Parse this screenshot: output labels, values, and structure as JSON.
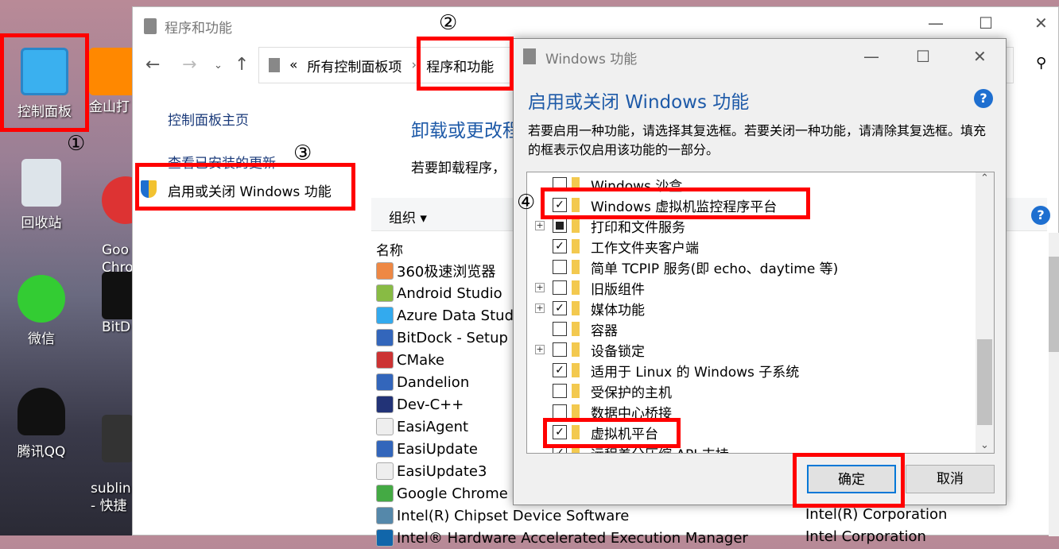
{
  "desktop": {
    "icons": [
      {
        "label": "控制面板"
      },
      {
        "label": "回收站"
      },
      {
        "label": "微信"
      },
      {
        "label": "腾讯QQ"
      }
    ],
    "icons_col2": [
      {
        "label": "金山打"
      },
      {
        "label": "Goo\nChro"
      },
      {
        "label": "BitD"
      },
      {
        "label": "sublin\n- 快捷"
      }
    ]
  },
  "explorer": {
    "title": "程序和功能",
    "breadcrumb": {
      "prefix": "«",
      "parent": "所有控制面板项",
      "sep": "›",
      "current": "程序和功能"
    },
    "left": {
      "home": "控制面板主页",
      "updates": "查看已安装的更新",
      "features": "启用或关闭 Windows 功能"
    },
    "main": {
      "heading": "卸载或更改程",
      "desc": "若要卸载程序，",
      "organize": "组织 ▾",
      "col_name": "名称",
      "programs": [
        {
          "name": "360极速浏览器",
          "color": "#e84"
        },
        {
          "name": "Android Studio",
          "color": "#8b4"
        },
        {
          "name": "Azure Data Studi",
          "color": "#3ae"
        },
        {
          "name": "BitDock - Setup v",
          "color": "#36b"
        },
        {
          "name": "CMake",
          "color": "#c33"
        },
        {
          "name": "Dandelion",
          "color": "#36b"
        },
        {
          "name": "Dev-C++",
          "color": "#237"
        },
        {
          "name": "EasiAgent",
          "color": "#eee"
        },
        {
          "name": "EasiUpdate",
          "color": "#36b"
        },
        {
          "name": "EasiUpdate3",
          "color": "#eee"
        },
        {
          "name": "Google Chrome",
          "color": "#4a4"
        },
        {
          "name": "Intel(R) Chipset Device Software",
          "color": "#58a",
          "publisher": "Intel(R) Corporation"
        },
        {
          "name": "Intel® Hardware Accelerated Execution Manager",
          "color": "#16a",
          "publisher": "Intel Corporation"
        }
      ]
    }
  },
  "dialog": {
    "title": "Windows 功能",
    "heading": "启用或关闭 Windows 功能",
    "desc": "若要启用一种功能，请选择其复选框。若要关闭一种功能，请清除其复选框。填充的框表示仅启用该功能的一部分。",
    "features": [
      {
        "label": "Windows 沙盒",
        "state": "unchecked",
        "expandable": false
      },
      {
        "label": "Windows 虚拟机监控程序平台",
        "state": "checked",
        "expandable": false
      },
      {
        "label": "打印和文件服务",
        "state": "partial",
        "expandable": true
      },
      {
        "label": "工作文件夹客户端",
        "state": "checked",
        "expandable": false
      },
      {
        "label": "简单 TCPIP 服务(即 echo、daytime 等)",
        "state": "unchecked",
        "expandable": false
      },
      {
        "label": "旧版组件",
        "state": "unchecked",
        "expandable": true
      },
      {
        "label": "媒体功能",
        "state": "checked",
        "expandable": true
      },
      {
        "label": "容器",
        "state": "unchecked",
        "expandable": false
      },
      {
        "label": "设备锁定",
        "state": "unchecked",
        "expandable": true
      },
      {
        "label": "适用于 Linux 的 Windows 子系统",
        "state": "checked",
        "expandable": false
      },
      {
        "label": "受保护的主机",
        "state": "unchecked",
        "expandable": false
      },
      {
        "label": "数据中心桥接",
        "state": "unchecked",
        "expandable": false
      },
      {
        "label": "虚拟机平台",
        "state": "checked",
        "expandable": false
      },
      {
        "label": "远程差分压缩 API 支持",
        "state": "checked",
        "expandable": false
      }
    ],
    "ok": "确定",
    "cancel": "取消"
  },
  "annotations": [
    "①",
    "②",
    "③",
    "④"
  ],
  "colors": {
    "link": "#1a3a7a",
    "heading": "#1e5aa8",
    "highlight": "#ff0000"
  }
}
